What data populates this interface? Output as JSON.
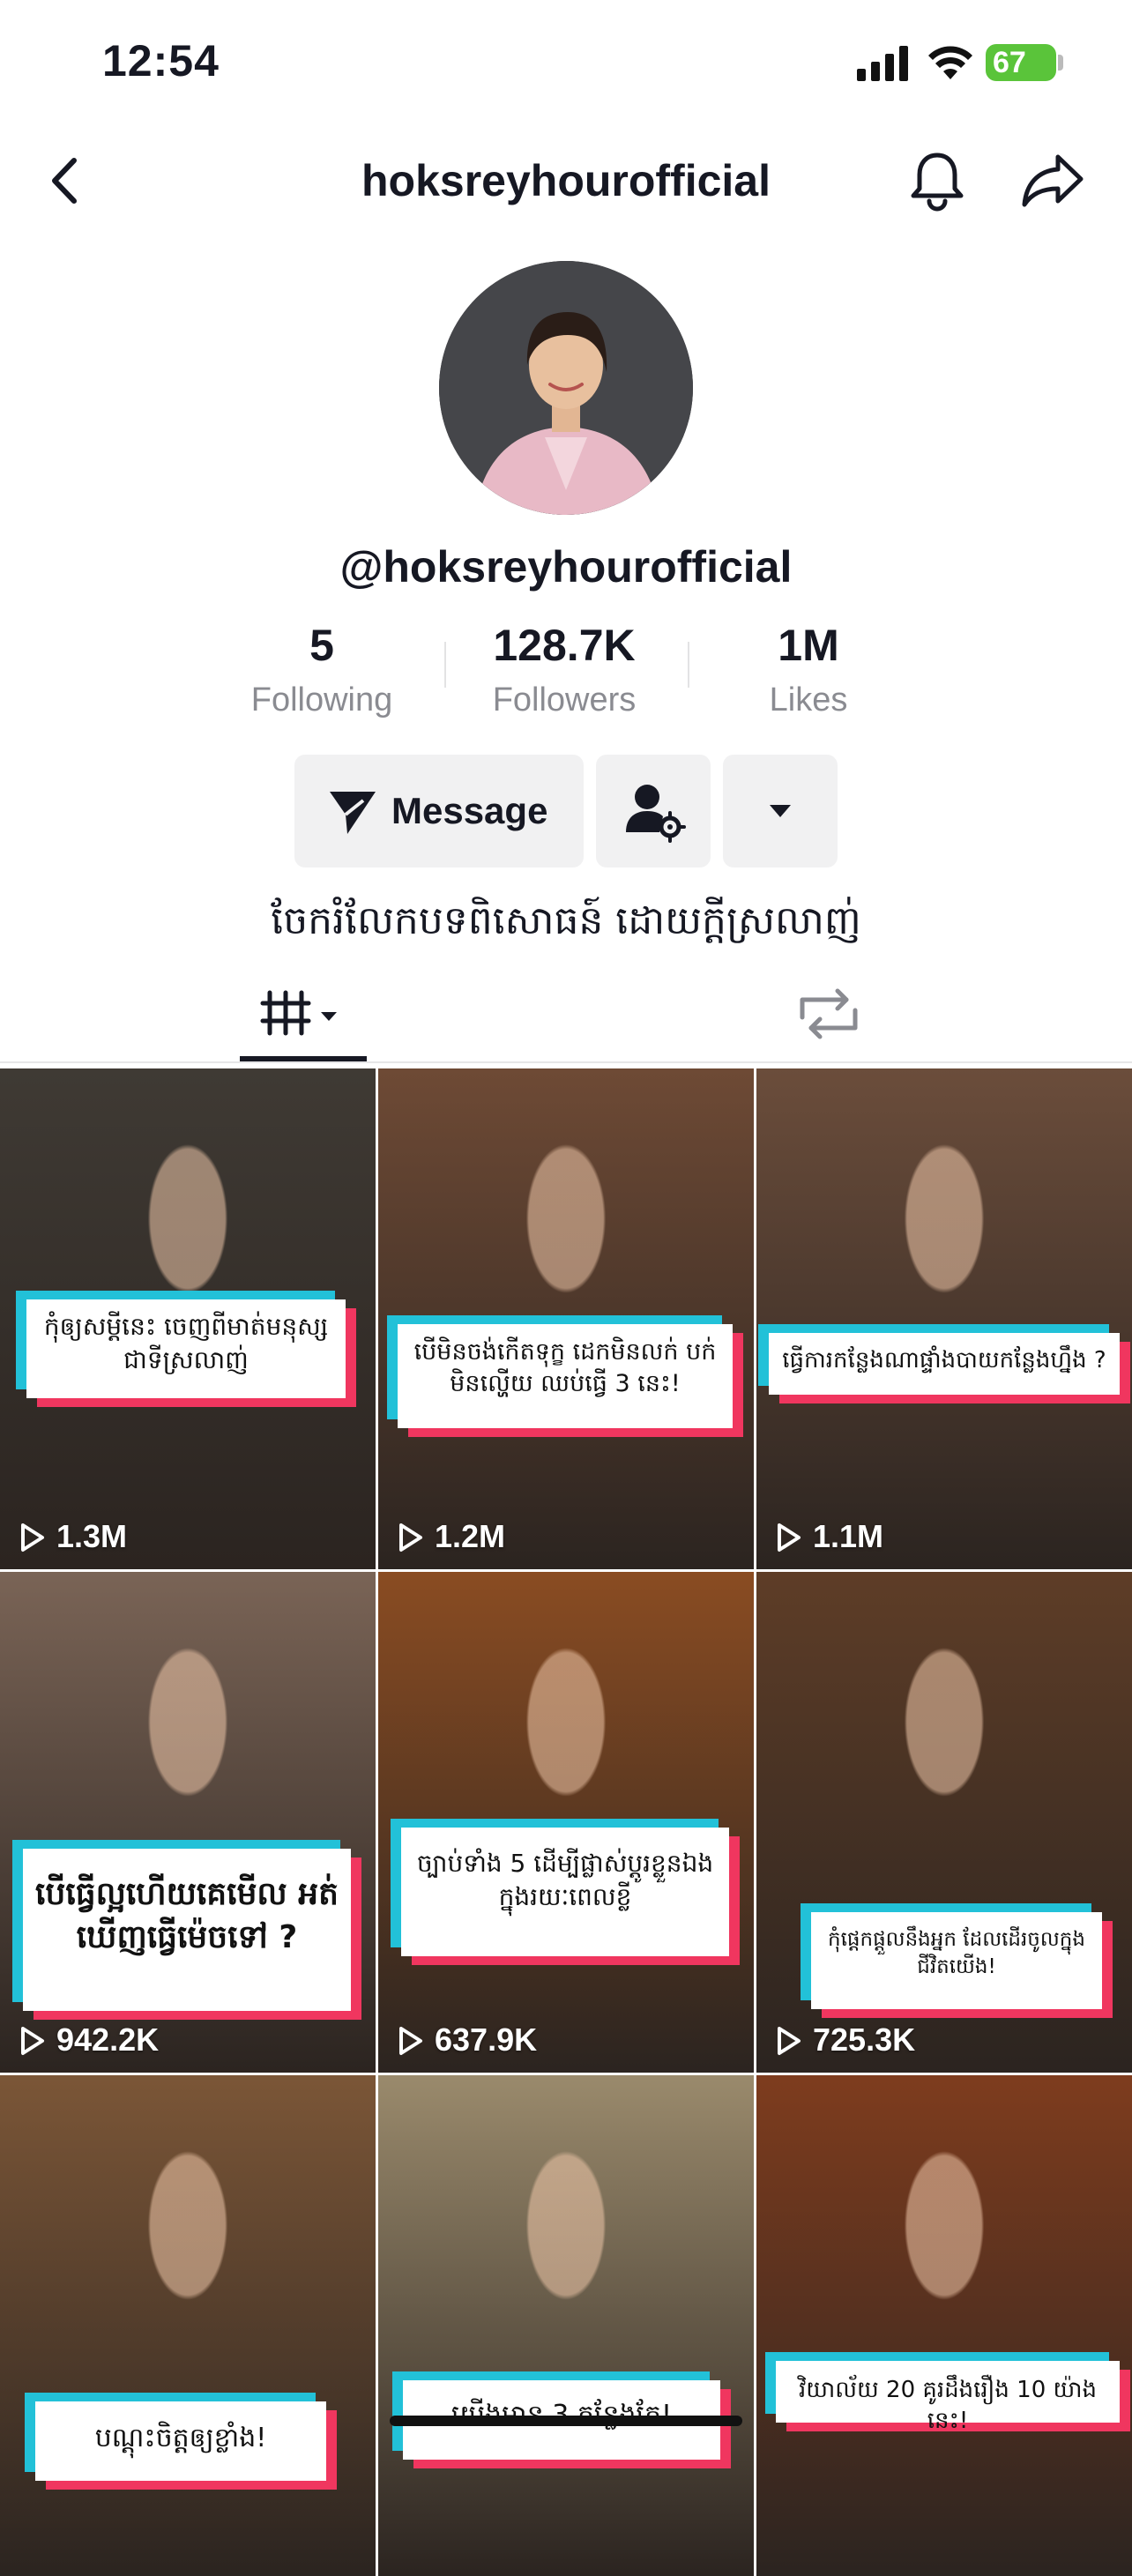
{
  "status_bar": {
    "time": "12:54",
    "battery": "67"
  },
  "header": {
    "title": "hoksreyhourofficial",
    "back_icon": "chevron-left-icon",
    "bell_icon": "bell-icon",
    "share_icon": "share-arrow-icon"
  },
  "profile": {
    "username": "@hoksreyhourofficial",
    "stats": [
      {
        "value": "5",
        "label": "Following"
      },
      {
        "value": "128.7K",
        "label": "Followers"
      },
      {
        "value": "1M",
        "label": "Likes"
      }
    ],
    "message_label": "Message",
    "bio": "ចែករំលែកបទពិសោធន៍ ដោយក្តីស្រលាញ់"
  },
  "tabs": {
    "videos_icon": "grid-icon",
    "reposts_icon": "repost-icon"
  },
  "videos": [
    {
      "caption": "កុំឲ្យសម្ដីនេះ ចេញពីមាត់មនុស្សជាទីស្រលាញ់",
      "views": "1.3M",
      "bg": "#3f3a34"
    },
    {
      "caption": "បើមិនចង់កើតទុក្ខ ដេកមិនលក់ បក់មិនល្ហើយ ឈប់ធ្វើ 3 នេះ!",
      "views": "1.2M",
      "bg": "#6e4a35"
    },
    {
      "caption": "ធ្វើការកន្លែងណាផ្ទាំងបាយកន្លែងហ្នឹង ?",
      "views": "1.1M",
      "bg": "#6b4d3b"
    },
    {
      "caption": "បើធ្វើល្អហើយគេមើល អត់ឃើញធ្វើម៉េចទៅ ?",
      "views": "942.2K",
      "bg": "#7a6456"
    },
    {
      "caption": "ច្បាប់ទាំង 5 ដើម្បីផ្លាស់ប្តូរខ្លួនឯង ក្នុងរយៈពេលខ្លី",
      "views": "637.9K",
      "bg": "#8a4c22"
    },
    {
      "caption": "កុំផ្ដេកផ្ដួលនឹងអ្នក ដែលដើរចូលក្នុងជីវិតយើង!",
      "views": "725.3K",
      "bg": "#5e3d27"
    },
    {
      "caption": "បណ្ដុះចិត្តឲ្យខ្លាំង!",
      "views": "",
      "bg": "#7b5637"
    },
    {
      "caption": "យើងមាន 3 កន្លែងតែ!",
      "views": "",
      "bg": "#9a8a6c"
    },
    {
      "caption": "វិយាល័យ 20 គូរដឹងរឿង 10 យ៉ាងនេះ!",
      "views": "",
      "bg": "#7e3c1e"
    }
  ]
}
